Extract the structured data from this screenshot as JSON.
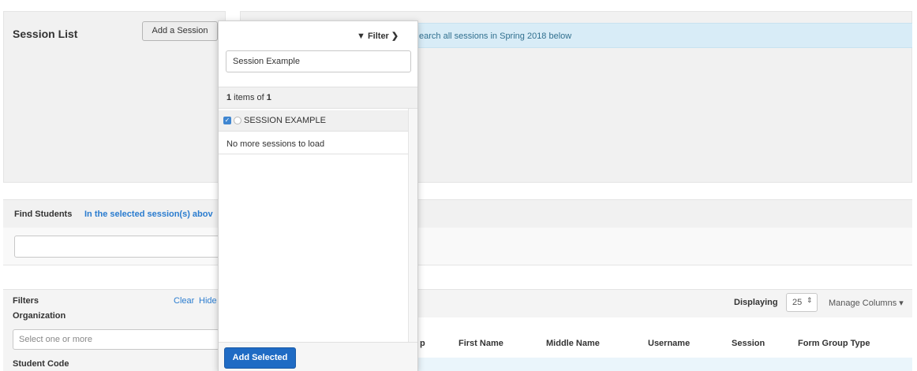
{
  "session_panel": {
    "title": "Session List",
    "add_session_label": "Add a Session"
  },
  "info_banner": {
    "text": "earch all sessions in Spring 2018 below"
  },
  "find_students": {
    "label": "Find Students",
    "link_text": "In the selected session(s) abov"
  },
  "filters": {
    "label": "Filters",
    "clear_label": "Clear",
    "hide_label": "Hide",
    "organization_label": "Organization",
    "organization_placeholder": "Select one or more",
    "student_code_label": "Student Code"
  },
  "results": {
    "displaying_label": "Displaying",
    "page_size": "25",
    "page_size_arrow": "⇕",
    "manage_columns_label": "Manage Columns ▾",
    "columns": [
      "p",
      "First Name",
      "Middle Name",
      "Username",
      "Session",
      "Form Group Type"
    ]
  },
  "popup": {
    "filter_label": "▼ Filter ❯",
    "search_value": "Session Example",
    "count_number": "1",
    "count_middle": " items of ",
    "count_total": "1",
    "items": [
      {
        "label": "SESSION EXAMPLE",
        "checked": true
      }
    ],
    "no_more_text": "No more sessions to load",
    "add_selected_label": "Add Selected"
  },
  "colors": {
    "primary_button": "#1f6bc4",
    "link": "#2a7ccf",
    "info_banner": "#d8ecf7",
    "checkbox": "#3f86d1"
  }
}
